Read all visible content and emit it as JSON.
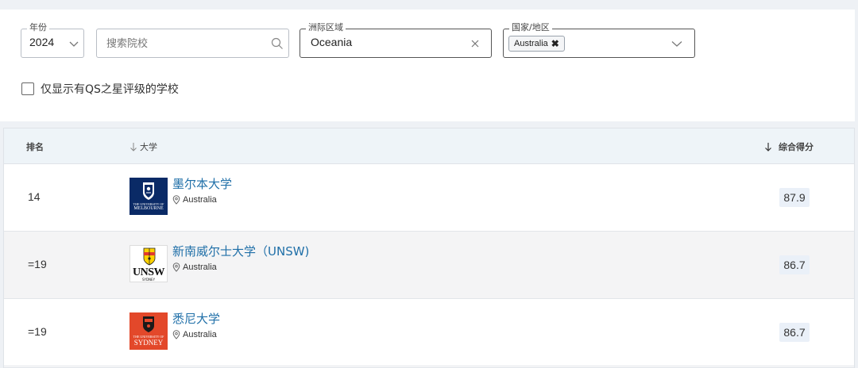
{
  "filters": {
    "year": {
      "label": "年份",
      "value": "2024"
    },
    "search": {
      "placeholder": "搜索院校"
    },
    "region": {
      "label": "洲际区域",
      "value": "Oceania"
    },
    "country": {
      "label": "国家/地区",
      "tag": "Australia",
      "tag_remove": "✖"
    },
    "qs_stars_only": {
      "label": "仅显示有QS之星评级的学校",
      "checked": false
    }
  },
  "table": {
    "headers": {
      "rank": "排名",
      "university": "大学",
      "score": "综合得分"
    },
    "rows": [
      {
        "rank": "14",
        "name": "墨尔本大学",
        "location": "Australia",
        "score": "87.9",
        "logo_text": [
          "THE UNIVERSITY OF",
          "MELBOURNE"
        ]
      },
      {
        "rank": "=19",
        "name": "新南威尔士大学（UNSW)",
        "location": "Australia",
        "score": "86.7",
        "logo_text": [
          "UNSW",
          "SYDNEY"
        ]
      },
      {
        "rank": "=19",
        "name": "悉尼大学",
        "location": "Australia",
        "score": "86.7",
        "logo_text": [
          "THE UNIVERSITY OF",
          "SYDNEY"
        ]
      }
    ]
  },
  "colors": {
    "link": "#1f6fa8",
    "melbourne_logo": "#0a2a66",
    "sydney_logo": "#e3482a",
    "header_bg": "#eef4f8"
  }
}
